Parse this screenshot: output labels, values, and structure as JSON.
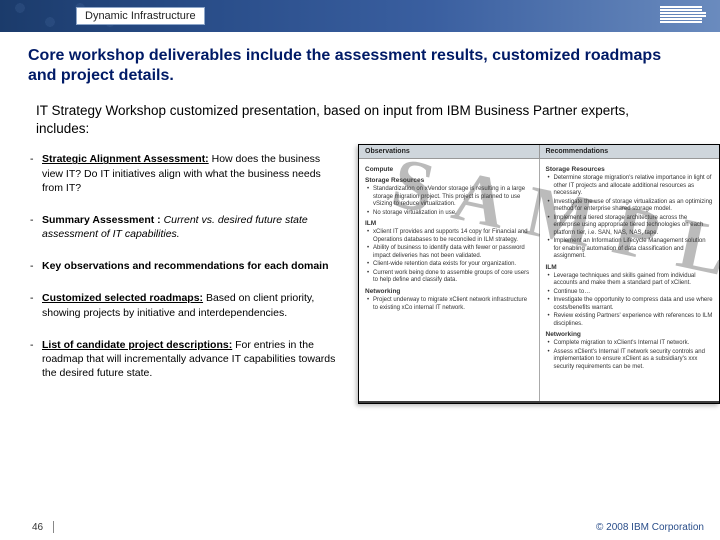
{
  "brand": {
    "tagline": "Dynamic Infrastructure",
    "logo_name": "IBM"
  },
  "slide": {
    "title": "Core workshop deliverables include the assessment results, customized roadmaps and project details.",
    "intro": "IT Strategy Workshop customized presentation, based on input from IBM Business Partner experts, includes:",
    "bullets": [
      {
        "lead": "Strategic Alignment Assessment:",
        "rest": " How does the business view IT? Do IT initiatives align with what the business needs from IT?",
        "style": "u"
      },
      {
        "lead": "Summary Assessment :",
        "rest": " Current vs. desired future state assessment of IT capabilities.",
        "style": "bold",
        "rest_style": "it"
      },
      {
        "lead": "Key observations and recommendations for each domain",
        "rest": "",
        "style": "bold"
      },
      {
        "lead": "Customized selected roadmaps:",
        "rest": " Based on client priority, showing projects by initiative and interdependencies.",
        "style": "u"
      },
      {
        "lead": "List of candidate project descriptions:",
        "rest": " For entries in the roadmap that will incrementally advance IT capabilities towards the desired future state.",
        "style": "u"
      }
    ]
  },
  "panel": {
    "head_left": "Observations",
    "head_right": "Recommendations",
    "watermark": "SAMPLE",
    "left": {
      "group": "Compute",
      "sec1_title": "Storage Resources",
      "sec1_items": [
        "Standardization on xVendor storage is resulting in a large storage migration project. This project is planned to use vSizing to reduce virtualization.",
        "No storage virtualization in use."
      ],
      "sec2_title": "ILM",
      "sec2_items": [
        "xClient IT provides and supports 14 copy for Financial and Operations databases to be reconciled in ILM strategy.",
        "Ability of business to identify data with fewer or password impact deliveries has not been validated.",
        "Client-wide retention data exists for your organization.",
        "Current work being done to assemble groups of core users to help define and classify data."
      ],
      "sec3_title": "Networking",
      "sec3_items": [
        "Project underway to migrate xClient network infrastructure to existing xCo internal IT network."
      ]
    },
    "right": {
      "sec1_title": "Storage Resources",
      "sec1_items": [
        "Determine storage migration's relative importance in light of other IT projects and allocate additional resources as necessary.",
        "Investigate the use of storage virtualization as an optimizing method for enterprise shared storage model.",
        "Implement a tiered storage architecture across the enterprise using appropriate tiered technologies on each platform tier, i.e. SAN, NAS, NAS, tape.",
        "Implement an Information Lifecycle Management solution for enabling automation of data classification and assignment."
      ],
      "sec2_title": "ILM",
      "sec2_items": [
        "Leverage techniques and skills gained from individual accounts and make them a standard part of xClient.",
        "Continue to…",
        "Investigate the opportunity to compress data and use where costs/benefits warrant.",
        "Review existing Partners' experience with references to ILM disciplines."
      ],
      "sec3_title": "Networking",
      "sec3_items": [
        "Complete migration to xClient's Internal IT network.",
        "Assess xClient's Internal IT network security controls and implementation to ensure xClient as a subsidiary's xxx security requirements can be met."
      ]
    }
  },
  "footer": {
    "page": "46",
    "copyright": "© 2008 IBM Corporation"
  }
}
